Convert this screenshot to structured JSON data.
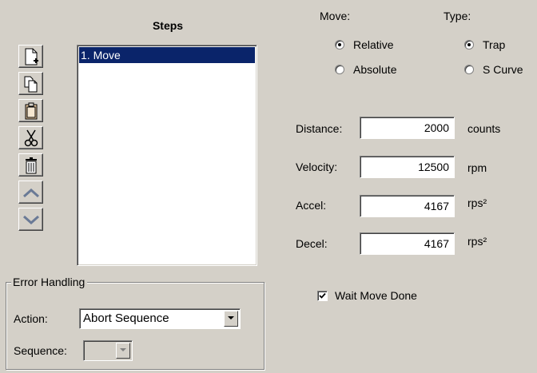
{
  "steps": {
    "title": "Steps",
    "toolbar": [
      {
        "name": "new-step-button",
        "icon": "new-document-icon"
      },
      {
        "name": "copy-step-button",
        "icon": "copy-icon"
      },
      {
        "name": "paste-step-button",
        "icon": "clipboard-icon"
      },
      {
        "name": "cut-step-button",
        "icon": "scissors-icon"
      },
      {
        "name": "delete-step-button",
        "icon": "trash-icon"
      },
      {
        "name": "move-up-button",
        "icon": "chevron-up-icon"
      },
      {
        "name": "move-down-button",
        "icon": "chevron-down-icon"
      }
    ],
    "items": [
      "1. Move"
    ],
    "selected_index": 0
  },
  "error_handling": {
    "title": "Error Handling",
    "action_label": "Action:",
    "action_value": "Abort Sequence",
    "sequence_label": "Sequence:",
    "sequence_value": ""
  },
  "move": {
    "label": "Move:",
    "options": [
      "Relative",
      "Absolute"
    ],
    "selected": "Relative"
  },
  "type": {
    "label": "Type:",
    "options": [
      "Trap",
      "S Curve"
    ],
    "selected": "Trap"
  },
  "params": {
    "distance": {
      "label": "Distance:",
      "value": "2000",
      "unit": "counts"
    },
    "velocity": {
      "label": "Velocity:",
      "value": "12500",
      "unit": "rpm"
    },
    "accel": {
      "label": "Accel:",
      "value": "4167",
      "unit": "rps²"
    },
    "decel": {
      "label": "Decel:",
      "value": "4167",
      "unit": "rps²"
    }
  },
  "wait_move_done": {
    "label": "Wait Move Done",
    "checked": true
  },
  "colors": {
    "selection": "#0a246a",
    "face": "#d4d0c8"
  }
}
